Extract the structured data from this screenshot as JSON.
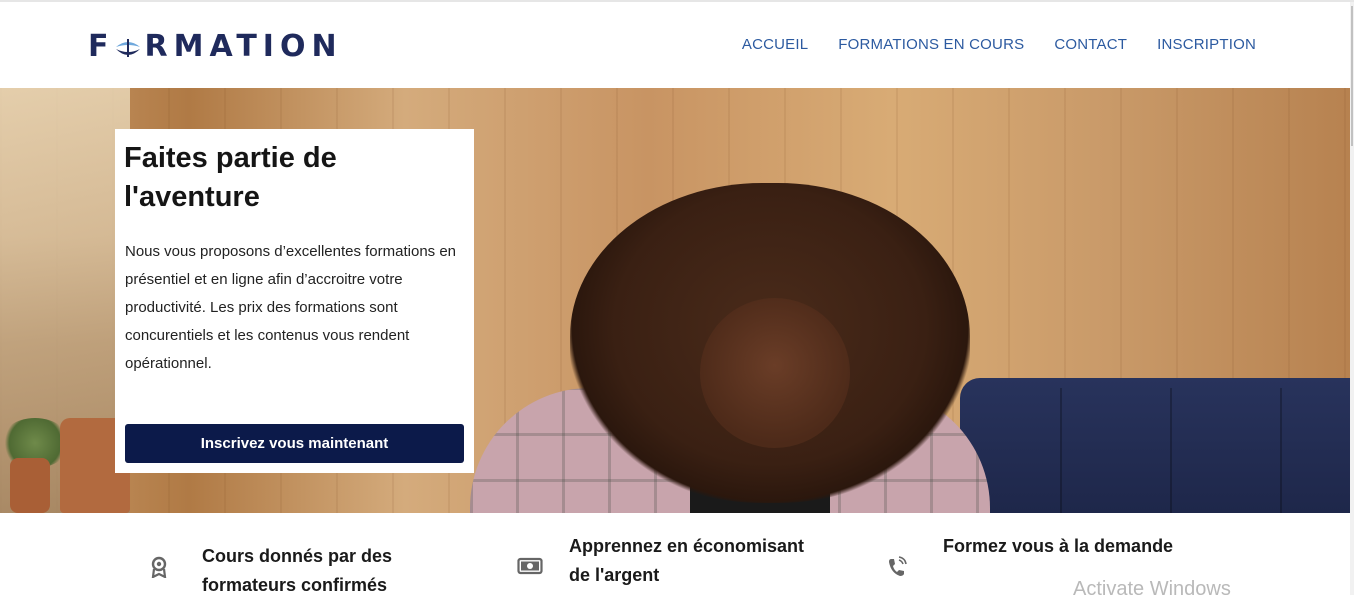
{
  "header": {
    "logo_text_left": "F",
    "logo_text_right": "RMATION",
    "nav": [
      "ACCUEIL",
      "FORMATIONS EN COURS",
      "CONTACT",
      "INSCRIPTION"
    ]
  },
  "hero": {
    "title": "Faites partie de l'aventure",
    "text": "Nous vous proposons d’excellentes formations en présentiel et en ligne afin d’accroitre votre productivité. Les prix des formations sont concurentiels et les contenus vous rendent opérationnel.",
    "cta_label": "Inscrivez vous maintenant"
  },
  "features": [
    {
      "title": "Cours donnés par des formateurs confirmés",
      "icon": "award-icon"
    },
    {
      "title": "Apprennez en économisant de l'argent",
      "icon": "money-icon"
    },
    {
      "title": "Formez vous à la demande",
      "icon": "phone-icon"
    }
  ],
  "colors": {
    "logo": "#1f2a5c",
    "nav": "#2c5aa0",
    "cta_bg": "#0c1a4a"
  },
  "watermark": "Activate Windows"
}
